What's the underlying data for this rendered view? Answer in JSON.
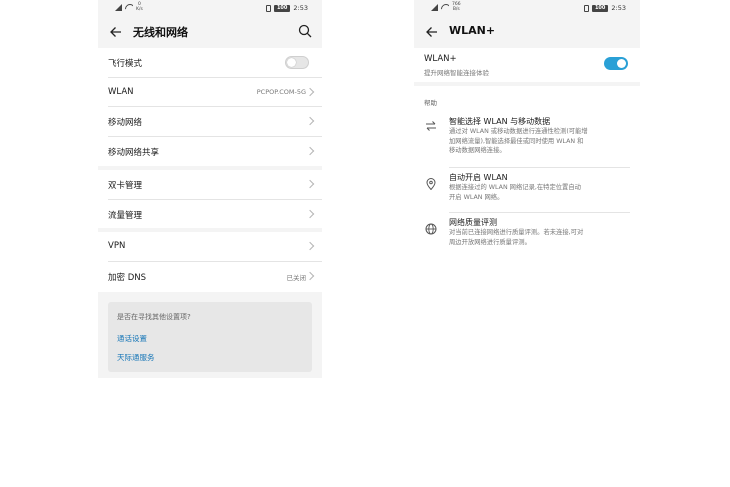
{
  "left_screen": {
    "status_bar": {
      "net_speed_value": "0",
      "net_speed_unit": "K/s",
      "battery": "100",
      "time": "2:53"
    },
    "title": "无线和网络",
    "group1": [
      {
        "label": "飞行模式",
        "value": "",
        "toggle": "off"
      },
      {
        "label": "WLAN",
        "value": "PCPOP.COM-5G"
      },
      {
        "label": "移动网络",
        "value": ""
      },
      {
        "label": "移动网络共享",
        "value": ""
      }
    ],
    "group2": [
      {
        "label": "双卡管理",
        "value": ""
      },
      {
        "label": "流量管理",
        "value": ""
      }
    ],
    "group3": [
      {
        "label": "VPN",
        "value": ""
      },
      {
        "label": "加密 DNS",
        "value": "已关闭"
      }
    ],
    "suggest": {
      "question": "是否在寻找其他设置项?",
      "links": [
        "通话设置",
        "天际通服务"
      ]
    }
  },
  "right_screen": {
    "status_bar": {
      "net_speed_value": "766",
      "net_speed_unit": "B/s",
      "battery": "100",
      "time": "2:53"
    },
    "title": "WLAN+",
    "wlan_plus": {
      "title": "WLAN+",
      "subtitle": "提升网络智能连接体验",
      "toggle": "on"
    },
    "help": {
      "heading": "帮助",
      "items": [
        {
          "icon": "swap-arrows-icon",
          "title": "智能选择 WLAN 与移动数据",
          "desc_lines": [
            "通过对 WLAN 或移动数据进行连通性检测(可能增",
            "加网络流量),智能选择最佳或同时使用 WLAN 和",
            "移动数据网络连接。"
          ]
        },
        {
          "icon": "location-pin-icon",
          "title": "自动开启 WLAN",
          "desc_lines": [
            "根据连接过的 WLAN 网络记录,在特定位置自动",
            "开启 WLAN 网络。"
          ]
        },
        {
          "icon": "globe-icon",
          "title": "网络质量评测",
          "desc_lines": [
            "对当前已连接网络进行质量评测。若未连接,可对",
            "周边开放网络进行质量评测。"
          ]
        }
      ]
    }
  },
  "colors": {
    "accent_blue": "#2aa0d6",
    "link_blue": "#1a78b8",
    "background_gray": "#f4f4f4"
  }
}
